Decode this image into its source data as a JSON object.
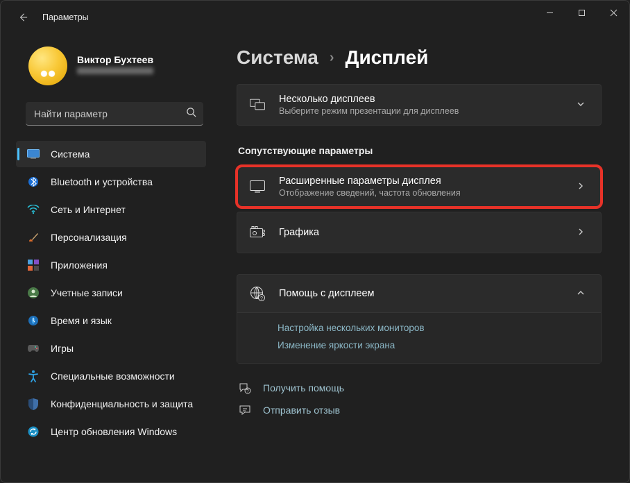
{
  "window": {
    "title": "Параметры"
  },
  "profile": {
    "name": "Виктор Бухтеев"
  },
  "search": {
    "placeholder": "Найти параметр"
  },
  "sidebar": {
    "items": [
      {
        "label": "Система"
      },
      {
        "label": "Bluetooth и устройства"
      },
      {
        "label": "Сеть и Интернет"
      },
      {
        "label": "Персонализация"
      },
      {
        "label": "Приложения"
      },
      {
        "label": "Учетные записи"
      },
      {
        "label": "Время и язык"
      },
      {
        "label": "Игры"
      },
      {
        "label": "Специальные возможности"
      },
      {
        "label": "Конфиденциальность и защита"
      },
      {
        "label": "Центр обновления Windows"
      }
    ]
  },
  "breadcrumb": {
    "parent": "Система",
    "sep": "›",
    "current": "Дисплей"
  },
  "cards": {
    "multi": {
      "title": "Несколько дисплеев",
      "sub": "Выберите режим презентации для дисплеев"
    },
    "advanced": {
      "title": "Расширенные параметры дисплея",
      "sub": "Отображение сведений, частота обновления"
    },
    "graphics": {
      "title": "Графика"
    }
  },
  "sections": {
    "related": "Сопутствующие параметры"
  },
  "help": {
    "title": "Помощь с дисплеем",
    "links": [
      "Настройка нескольких мониторов",
      "Изменение яркости экрана"
    ]
  },
  "footer": {
    "get_help": "Получить помощь",
    "feedback": "Отправить отзыв"
  }
}
